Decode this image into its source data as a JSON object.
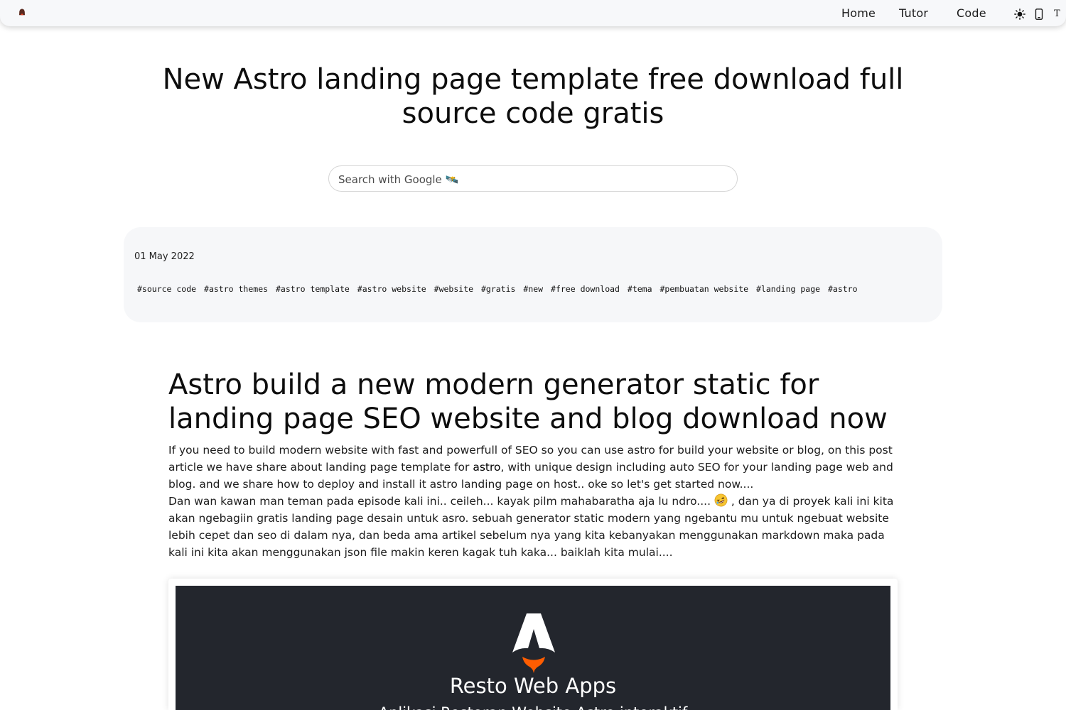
{
  "nav": {
    "logo_icon": "site-logo-icon",
    "links": [
      "Home",
      "Tutor",
      "Code"
    ],
    "theme_icon": "sun-icon",
    "device_icon": "mobile-phone-icon",
    "font_toggle": "T"
  },
  "header": {
    "title": "New Astro landing page template free download full source code gratis"
  },
  "search": {
    "placeholder": "Search with Google 🛰️"
  },
  "meta": {
    "date": "01 May 2022",
    "tags": [
      "#source code",
      "#astro themes",
      "#astro template",
      "#astro website",
      "#website",
      "#gratis",
      "#new",
      "#free download",
      "#tema",
      "#pembuatan website",
      "#landing page",
      "#astro"
    ]
  },
  "article": {
    "title": "Astro build a new modern generator static for landing page SEO website and blog download now",
    "intro_before_link": "If you need to build modern website with fast and powerfull of SEO so you can use astro for build your website or blog, on this post article we have share about landing page template for ",
    "intro_link": "astro",
    "intro_after_link": ", with unique design including auto SEO for your landing page web and blog. and we share how to deploy and install it astro landing page on host.. oke so let's get started now....",
    "p2_before_emoji": "Dan wan kawan man teman pada episode kali ini.. ceileh... kayak pilm mahabaratha aja lu ndro.... ",
    "p2_emoji": "rolling-on-floor-laughing-emoji",
    "p2_after_emoji": " , dan ya di proyek kali ini kita akan ngebagiin gratis landing page desain untuk asro. sebuah generator static modern yang ngebantu mu untuk ngebuat website lebih cepet dan seo di dalam nya, dan beda ama artikel sebelum nya yang kita kebanyakan menggunakan markdown maka pada kali ini kita akan menggunakan json file makin keren kagak tuh kaka... baiklah kita mulai...."
  },
  "preview": {
    "logo_icon": "astro-logo-icon",
    "title": "Resto Web Apps",
    "subtitle": "Aplikasi Restoran Website Astro interaktif",
    "background": "#23262d",
    "flame_color": "#ff5d01"
  }
}
